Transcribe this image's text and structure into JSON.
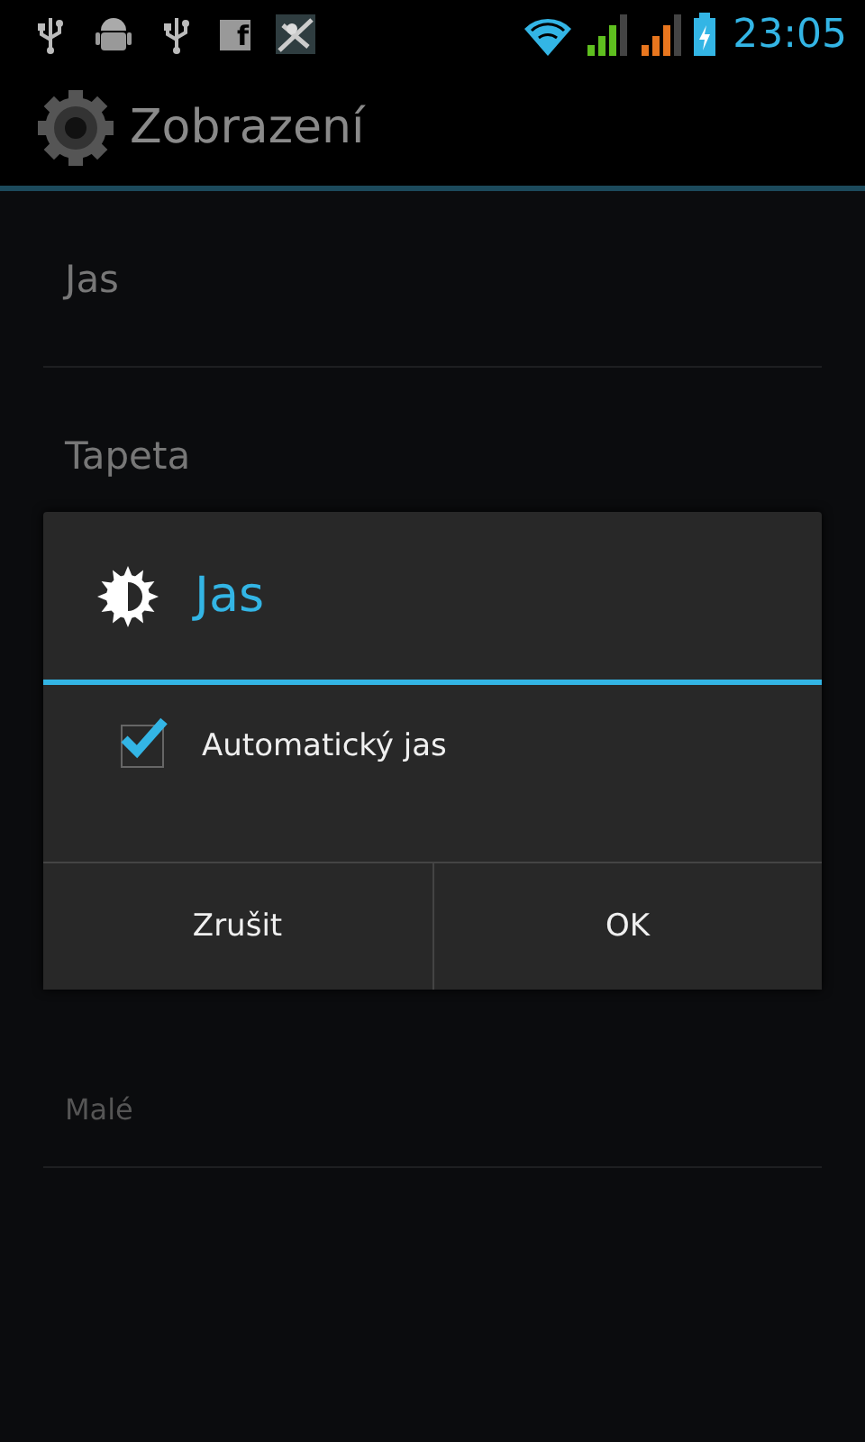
{
  "status_bar": {
    "notifications": [
      {
        "kind": "usb"
      },
      {
        "kind": "android"
      },
      {
        "kind": "usb"
      },
      {
        "kind": "facebook",
        "glyph": "f"
      },
      {
        "kind": "app"
      }
    ],
    "signals": [
      {
        "color": "#5fbf1f"
      },
      {
        "color": "#e8761e"
      }
    ],
    "battery": {
      "charging": true
    },
    "time": "23:05"
  },
  "action_bar": {
    "title": "Zobrazení"
  },
  "settings": [
    {
      "title": "Jas"
    },
    {
      "title": "Tapeta"
    },
    {
      "summary": "Malé"
    }
  ],
  "dialog": {
    "title": "Jas",
    "options": [
      {
        "label": "Automatický jas",
        "checked": true
      }
    ],
    "buttons": [
      "Zrušit",
      "OK"
    ]
  }
}
